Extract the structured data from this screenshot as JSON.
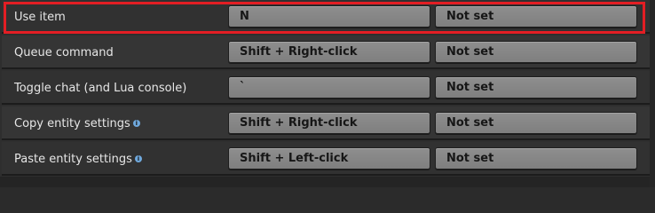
{
  "rows": [
    {
      "label": "Use item",
      "primary": "N",
      "secondary": "Not set",
      "info": false
    },
    {
      "label": "Queue command",
      "primary": "Shift + Right-click",
      "secondary": "Not set",
      "info": false
    },
    {
      "label": "Toggle chat (and Lua console)",
      "primary": "`",
      "secondary": "Not set",
      "info": false
    },
    {
      "label": "Copy entity settings",
      "primary": "Shift + Right-click",
      "secondary": "Not set",
      "info": true
    },
    {
      "label": "Paste entity settings",
      "primary": "Shift + Left-click",
      "secondary": "Not set",
      "info": true
    }
  ],
  "info_icon_glyph": "i",
  "colors": {
    "highlight": "#e31e24",
    "button": "#878787",
    "info_icon": "#6fa8dc"
  },
  "icons": {
    "info": "info-icon"
  }
}
